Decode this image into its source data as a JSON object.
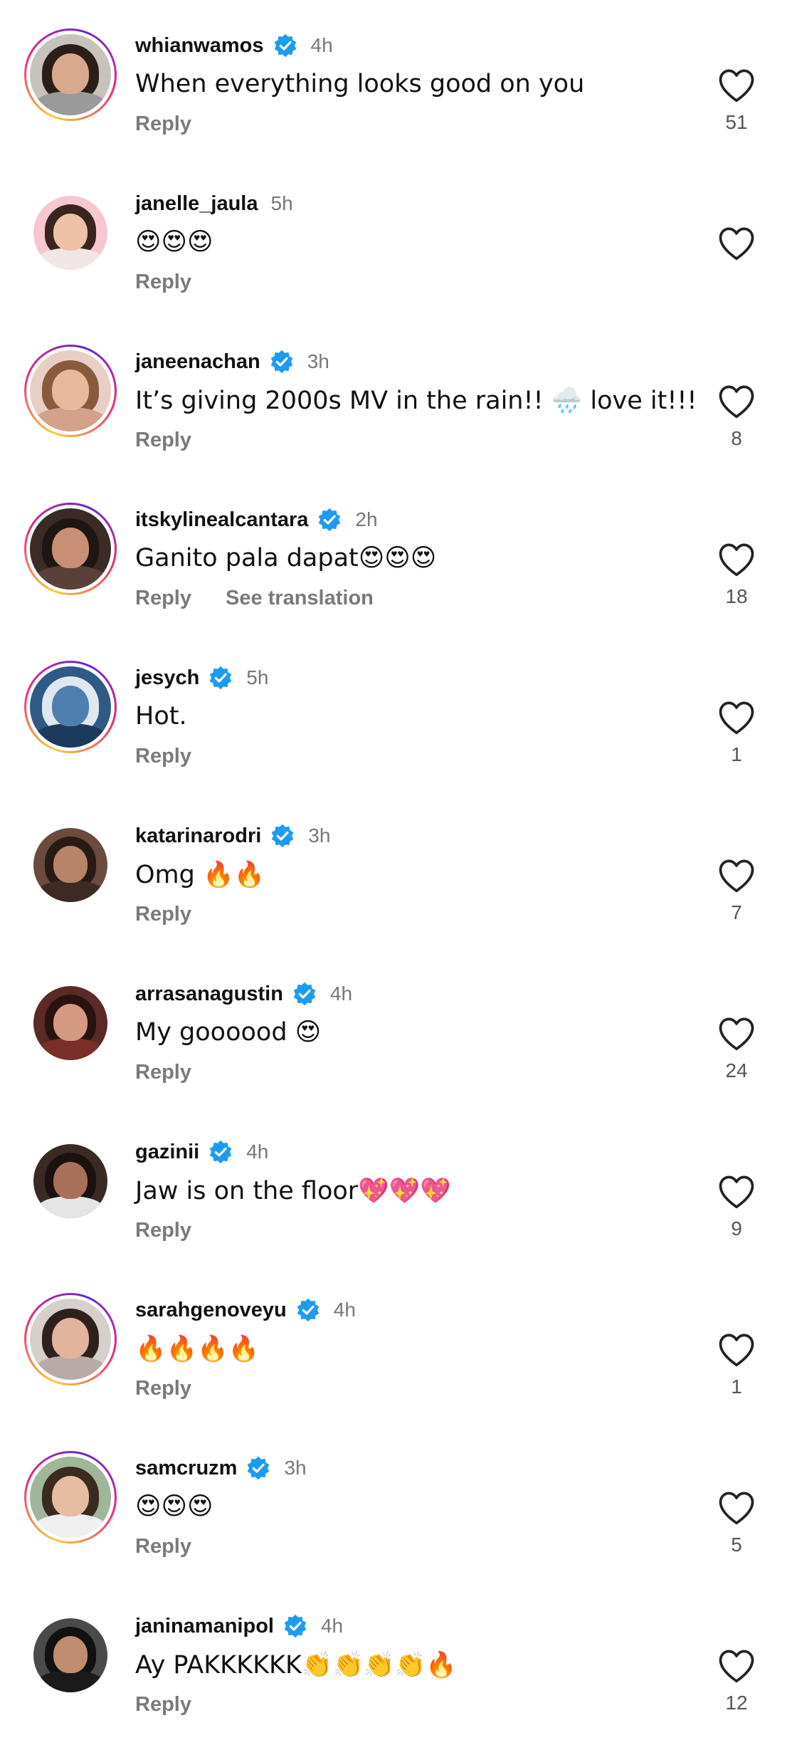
{
  "comments": [
    {
      "username": "whianwamos",
      "verified": true,
      "time": "4h",
      "text": "When everything looks good on you",
      "likes": "51",
      "story_ring": true,
      "avatar_icon": "woman-dark-hair-icon",
      "avatar_bg": "#c8c2bd",
      "hair": "#2b1e19",
      "skin": "#d8a98c",
      "top": "#9a9a9a"
    },
    {
      "username": "janelle_jaula",
      "verified": false,
      "time": "5h",
      "text": "😍😍😍",
      "likes": "",
      "story_ring": false,
      "avatar_icon": "woman-pink-bg-icon",
      "avatar_bg": "#f6c7d0",
      "hair": "#3a2420",
      "skin": "#efc1a6",
      "top": "#f1e6e6"
    },
    {
      "username": "janeenachan",
      "verified": true,
      "time": "3h",
      "text": "It’s giving 2000s MV in the rain!! 🌧️ love it!!!",
      "likes": "8",
      "story_ring": true,
      "avatar_icon": "woman-light-hair-icon",
      "avatar_bg": "#e8cfc6",
      "hair": "#8a5a3c",
      "skin": "#eab89c",
      "top": "#d4a28a"
    },
    {
      "username": "itskylinealcantara",
      "verified": true,
      "time": "2h",
      "text": "Ganito pala dapat😍😍😍",
      "likes": "18",
      "story_ring": true,
      "avatar_icon": "woman-red-glasses-icon",
      "avatar_bg": "#3a2b26",
      "hair": "#1f1512",
      "skin": "#c98f74",
      "top": "#5a4038"
    },
    {
      "username": "jesych",
      "verified": true,
      "time": "5h",
      "text": "Hot.",
      "likes": "1",
      "story_ring": true,
      "avatar_icon": "earth-globe-icon",
      "avatar_bg": "#2f5a86",
      "hair": "#dfe8ee",
      "skin": "#4f7fae",
      "top": "#1c3b5c"
    },
    {
      "username": "katarinarodri",
      "verified": true,
      "time": "3h",
      "text": "Omg 🔥🔥",
      "likes": "7",
      "story_ring": false,
      "avatar_icon": "woman-dark-portrait-icon",
      "avatar_bg": "#6a4b3e",
      "hair": "#2a1a14",
      "skin": "#b98368",
      "top": "#3d2a22"
    },
    {
      "username": "arrasanagustin",
      "verified": true,
      "time": "4h",
      "text": "My goooood 😍",
      "likes": "24",
      "story_ring": false,
      "avatar_icon": "woman-red-portrait-icon",
      "avatar_bg": "#5a2a26",
      "hair": "#2a1210",
      "skin": "#d49a82",
      "top": "#7a2e2a"
    },
    {
      "username": "gazinii",
      "verified": true,
      "time": "4h",
      "text": "Jaw is on the floor💖💖💖",
      "likes": "9",
      "story_ring": false,
      "avatar_icon": "woman-face-mask-icon",
      "avatar_bg": "#3b2a24",
      "hair": "#1b1210",
      "skin": "#a87058",
      "top": "#e5e5e5"
    },
    {
      "username": "sarahgenoveyu",
      "verified": true,
      "time": "4h",
      "text": "🔥🔥🔥🔥",
      "likes": "1",
      "story_ring": true,
      "avatar_icon": "woman-long-hair-icon",
      "avatar_bg": "#d7cfcc",
      "hair": "#2e201c",
      "skin": "#e3b49d",
      "top": "#b8aaa6"
    },
    {
      "username": "samcruzm",
      "verified": true,
      "time": "3h",
      "text": "😍😍😍",
      "likes": "5",
      "story_ring": true,
      "avatar_icon": "woman-outdoor-icon",
      "avatar_bg": "#9fb69a",
      "hair": "#3b2a1f",
      "skin": "#e6bda3",
      "top": "#efefef"
    },
    {
      "username": "janinamanipol",
      "verified": true,
      "time": "4h",
      "text": "Ay PAKKKKKK👏👏👏👏🔥",
      "likes": "12",
      "story_ring": false,
      "avatar_icon": "woman-black-hair-icon",
      "avatar_bg": "#4a4a4a",
      "hair": "#111111",
      "skin": "#c08c70",
      "top": "#1a1a1a"
    }
  ],
  "labels": {
    "reply": "Reply",
    "see_translation": "See translation"
  },
  "colors": {
    "verified_badge": "#1d9bf0",
    "muted_text": "#7a7a7a",
    "like_icon": "#222222"
  }
}
